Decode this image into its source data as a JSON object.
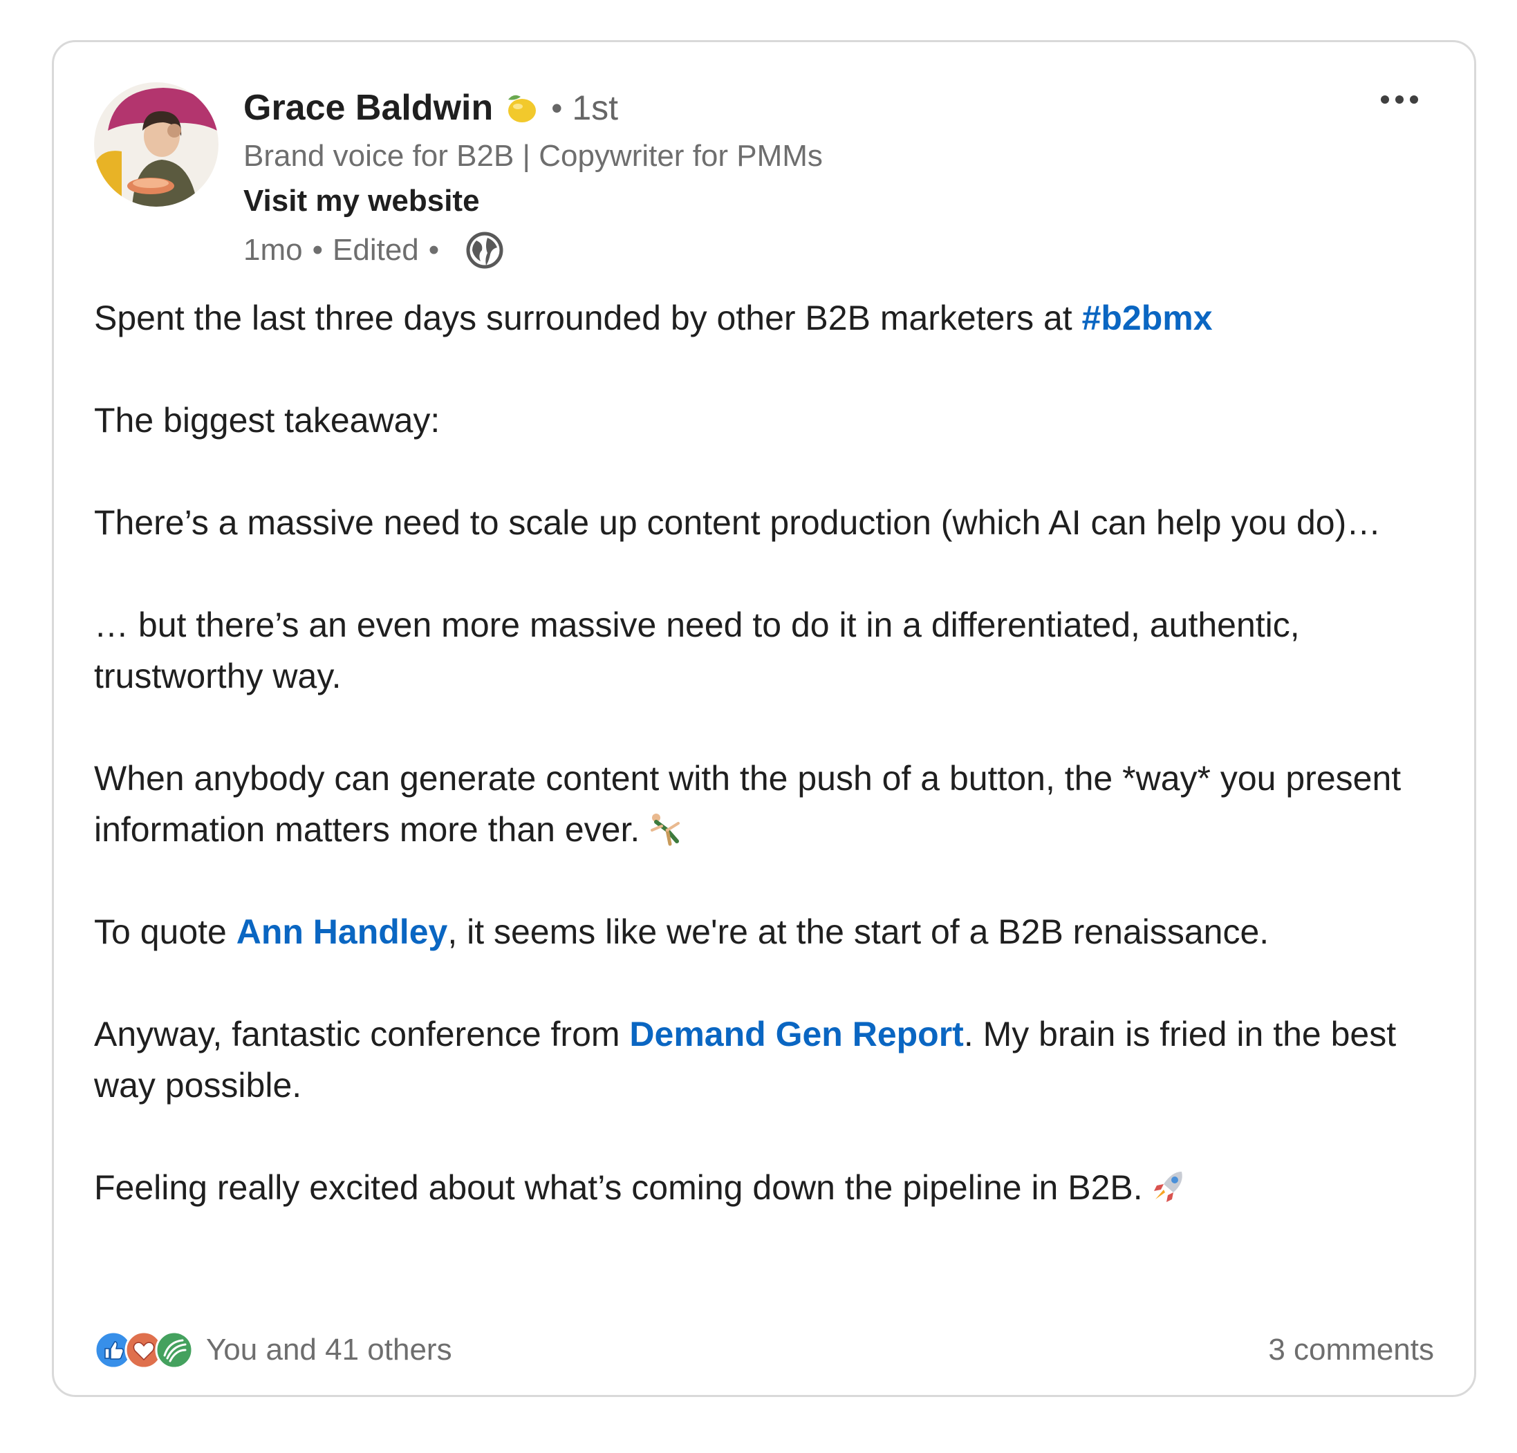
{
  "author": {
    "name": "Grace Baldwin",
    "badge_icon": "lemon-icon",
    "separator": "•",
    "degree": "1st",
    "headline": "Brand voice for B2B | Copywriter for PMMs",
    "website_label": "Visit my website"
  },
  "meta": {
    "time": "1mo",
    "separator": "•",
    "edited": "Edited",
    "visibility_icon": "globe-icon"
  },
  "menu": {
    "icon": "more-options-icon"
  },
  "post": {
    "p1_text": "Spent the last three days surrounded by other B2B marketers at ",
    "p1_hashtag": "#b2bmx",
    "p2": "The biggest takeaway:",
    "p3": "There’s a massive need to scale up content production (which AI can help you do)…",
    "p4": "… but there’s an even more massive need to do it in a differentiated, authentic, trustworthy way.",
    "p5": "When anybody can generate content with the push of a button, the *way* you present information matters more than ever.",
    "p5_emoji": "cartwheel-emoji",
    "p6_before": "To quote ",
    "p6_mention": "Ann Handley",
    "p6_after": ", it seems like we're at the start of a B2B renaissance.",
    "p7_before": "Anyway, fantastic conference from ",
    "p7_mention": "Demand Gen Report",
    "p7_after": ". My brain is fried in the best way possible.",
    "p8": "Feeling really excited about what’s coming down the pipeline in B2B.",
    "p8_emoji": "rocket-emoji"
  },
  "footer": {
    "reaction_icons": [
      "like-icon",
      "love-icon",
      "support-icon"
    ],
    "reactions_text": "You and 41 others",
    "comments_text": "3 comments"
  },
  "colors": {
    "link": "#0a66c2",
    "secondary_text": "#6e6e6e",
    "primary_text": "#1f1f1f",
    "border": "#d9d9d9",
    "like": "#378fe9",
    "love": "#df704d",
    "support": "#44a15e"
  }
}
